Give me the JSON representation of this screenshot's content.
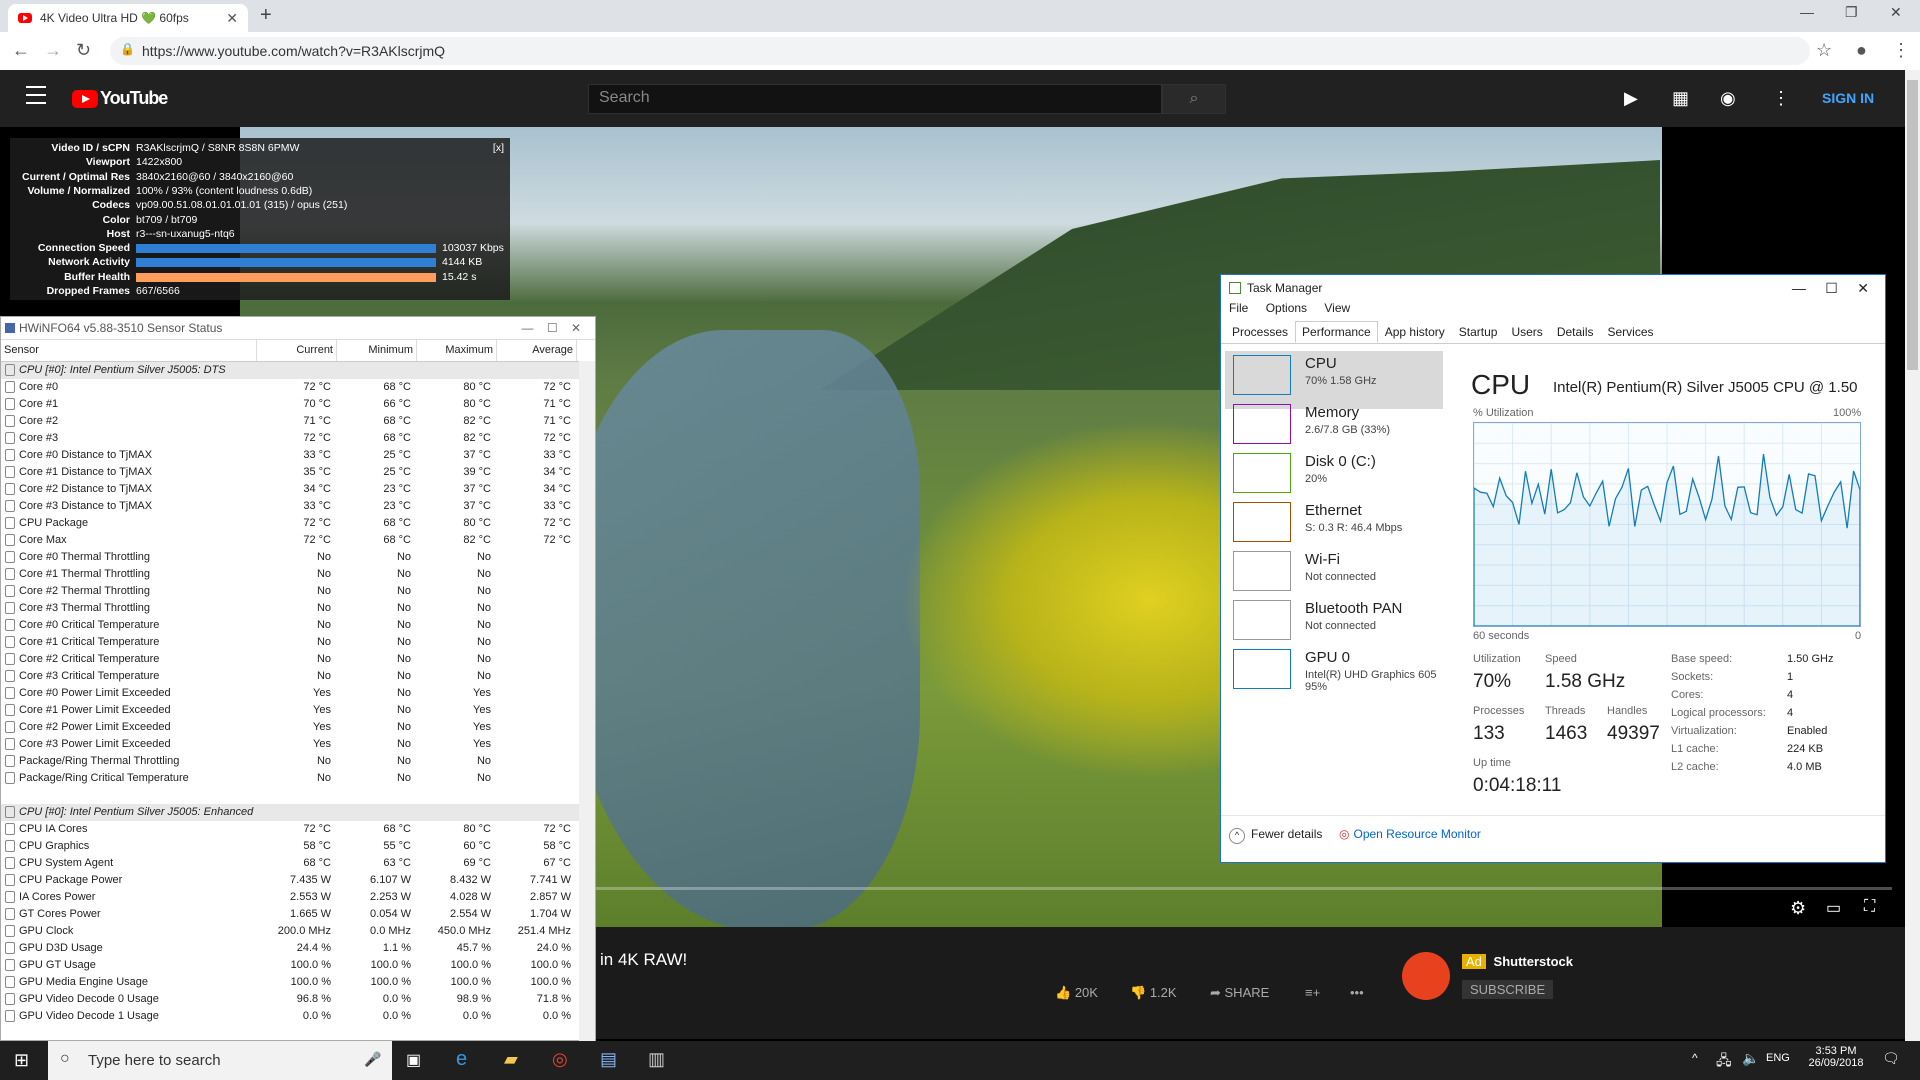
{
  "browser": {
    "tab_title": "4K Video Ultra HD 💚 60fps",
    "url": "https://www.youtube.com/watch?v=R3AKlscrjmQ"
  },
  "youtube": {
    "search_placeholder": "Search",
    "sign_in": "SIGN IN",
    "logo": "YouTube",
    "video_title": "in 4K RAW!",
    "likes": "20K",
    "dislikes": "1.2K",
    "share": "SHARE",
    "ad_label": "Ad",
    "ad_name": "Shutterstock",
    "subscribe": "SUBSCRIBE"
  },
  "stats": {
    "close": "[x]",
    "rows": [
      {
        "k": "Video ID / sCPN",
        "v": "R3AKlscrjmQ / S8NR 8S8N 6PMW"
      },
      {
        "k": "Viewport",
        "v": "1422x800"
      },
      {
        "k": "Current / Optimal Res",
        "v": "3840x2160@60 / 3840x2160@60"
      },
      {
        "k": "Volume / Normalized",
        "v": "100% / 93% (content loudness 0.6dB)"
      },
      {
        "k": "Codecs",
        "v": "vp09.00.51.08.01.01.01.01 (315) / opus (251)"
      },
      {
        "k": "Color",
        "v": "bt709 / bt709"
      },
      {
        "k": "Host",
        "v": "r3---sn-uxanug5-ntq6"
      },
      {
        "k": "Connection Speed",
        "v": "103037 Kbps"
      },
      {
        "k": "Network Activity",
        "v": "4144 KB"
      },
      {
        "k": "Buffer Health",
        "v": "15.42 s"
      },
      {
        "k": "Dropped Frames",
        "v": "667/6566"
      }
    ]
  },
  "hwinfo": {
    "title": "HWiNFO64 v5.88-3510 Sensor Status",
    "columns": [
      "Sensor",
      "Current",
      "Minimum",
      "Maximum",
      "Average"
    ],
    "rows": [
      {
        "group": true,
        "n": "CPU [#0]: Intel Pentium Silver J5005: DTS"
      },
      {
        "n": "Core #0",
        "c": "72 °C",
        "mi": "68 °C",
        "ma": "80 °C",
        "a": "72 °C"
      },
      {
        "n": "Core #1",
        "c": "70 °C",
        "mi": "66 °C",
        "ma": "80 °C",
        "a": "71 °C"
      },
      {
        "n": "Core #2",
        "c": "71 °C",
        "mi": "68 °C",
        "ma": "82 °C",
        "a": "71 °C"
      },
      {
        "n": "Core #3",
        "c": "72 °C",
        "mi": "68 °C",
        "ma": "82 °C",
        "a": "72 °C"
      },
      {
        "n": "Core #0 Distance to TjMAX",
        "c": "33 °C",
        "mi": "25 °C",
        "ma": "37 °C",
        "a": "33 °C"
      },
      {
        "n": "Core #1 Distance to TjMAX",
        "c": "35 °C",
        "mi": "25 °C",
        "ma": "39 °C",
        "a": "34 °C"
      },
      {
        "n": "Core #2 Distance to TjMAX",
        "c": "34 °C",
        "mi": "23 °C",
        "ma": "37 °C",
        "a": "34 °C"
      },
      {
        "n": "Core #3 Distance to TjMAX",
        "c": "33 °C",
        "mi": "23 °C",
        "ma": "37 °C",
        "a": "33 °C"
      },
      {
        "n": "CPU Package",
        "c": "72 °C",
        "mi": "68 °C",
        "ma": "80 °C",
        "a": "72 °C"
      },
      {
        "n": "Core Max",
        "c": "72 °C",
        "mi": "68 °C",
        "ma": "82 °C",
        "a": "72 °C"
      },
      {
        "n": "Core #0 Thermal Throttling",
        "c": "No",
        "mi": "No",
        "ma": "No",
        "a": ""
      },
      {
        "n": "Core #1 Thermal Throttling",
        "c": "No",
        "mi": "No",
        "ma": "No",
        "a": ""
      },
      {
        "n": "Core #2 Thermal Throttling",
        "c": "No",
        "mi": "No",
        "ma": "No",
        "a": ""
      },
      {
        "n": "Core #3 Thermal Throttling",
        "c": "No",
        "mi": "No",
        "ma": "No",
        "a": ""
      },
      {
        "n": "Core #0 Critical Temperature",
        "c": "No",
        "mi": "No",
        "ma": "No",
        "a": ""
      },
      {
        "n": "Core #1 Critical Temperature",
        "c": "No",
        "mi": "No",
        "ma": "No",
        "a": ""
      },
      {
        "n": "Core #2 Critical Temperature",
        "c": "No",
        "mi": "No",
        "ma": "No",
        "a": ""
      },
      {
        "n": "Core #3 Critical Temperature",
        "c": "No",
        "mi": "No",
        "ma": "No",
        "a": ""
      },
      {
        "n": "Core #0 Power Limit Exceeded",
        "c": "Yes",
        "mi": "No",
        "ma": "Yes",
        "a": ""
      },
      {
        "n": "Core #1 Power Limit Exceeded",
        "c": "Yes",
        "mi": "No",
        "ma": "Yes",
        "a": ""
      },
      {
        "n": "Core #2 Power Limit Exceeded",
        "c": "Yes",
        "mi": "No",
        "ma": "Yes",
        "a": ""
      },
      {
        "n": "Core #3 Power Limit Exceeded",
        "c": "Yes",
        "mi": "No",
        "ma": "Yes",
        "a": ""
      },
      {
        "n": "Package/Ring Thermal Throttling",
        "c": "No",
        "mi": "No",
        "ma": "No",
        "a": ""
      },
      {
        "n": "Package/Ring Critical Temperature",
        "c": "No",
        "mi": "No",
        "ma": "No",
        "a": ""
      },
      {
        "spacer": true
      },
      {
        "group": true,
        "n": "CPU [#0]: Intel Pentium Silver J5005: Enhanced"
      },
      {
        "n": "CPU IA Cores",
        "c": "72 °C",
        "mi": "68 °C",
        "ma": "80 °C",
        "a": "72 °C"
      },
      {
        "n": "CPU Graphics",
        "c": "58 °C",
        "mi": "55 °C",
        "ma": "60 °C",
        "a": "58 °C"
      },
      {
        "n": "CPU System Agent",
        "c": "68 °C",
        "mi": "63 °C",
        "ma": "69 °C",
        "a": "67 °C"
      },
      {
        "n": "CPU Package Power",
        "c": "7.435 W",
        "mi": "6.107 W",
        "ma": "8.432 W",
        "a": "7.741 W"
      },
      {
        "n": "IA Cores Power",
        "c": "2.553 W",
        "mi": "2.253 W",
        "ma": "4.028 W",
        "a": "2.857 W"
      },
      {
        "n": "GT Cores Power",
        "c": "1.665 W",
        "mi": "0.054 W",
        "ma": "2.554 W",
        "a": "1.704 W"
      },
      {
        "n": "GPU Clock",
        "c": "200.0 MHz",
        "mi": "0.0 MHz",
        "ma": "450.0 MHz",
        "a": "251.4 MHz"
      },
      {
        "n": "GPU D3D Usage",
        "c": "24.4 %",
        "mi": "1.1 %",
        "ma": "45.7 %",
        "a": "24.0 %"
      },
      {
        "n": "GPU GT Usage",
        "c": "100.0 %",
        "mi": "100.0 %",
        "ma": "100.0 %",
        "a": "100.0 %"
      },
      {
        "n": "GPU Media Engine Usage",
        "c": "100.0 %",
        "mi": "100.0 %",
        "ma": "100.0 %",
        "a": "100.0 %"
      },
      {
        "n": "GPU Video Decode 0 Usage",
        "c": "96.8 %",
        "mi": "0.0 %",
        "ma": "98.9 %",
        "a": "71.8 %"
      },
      {
        "n": "GPU Video Decode 1 Usage",
        "c": "0.0 %",
        "mi": "0.0 %",
        "ma": "0.0 %",
        "a": "0.0 %"
      }
    ]
  },
  "taskmgr": {
    "title": "Task Manager",
    "menu": [
      "File",
      "Options",
      "View"
    ],
    "tabs": [
      "Processes",
      "Performance",
      "App history",
      "Startup",
      "Users",
      "Details",
      "Services"
    ],
    "items": [
      {
        "t": "CPU",
        "s": "70% 1.58 GHz",
        "color": "#117dbb"
      },
      {
        "t": "Memory",
        "s": "2.6/7.8 GB (33%)",
        "color": "#8b12ae"
      },
      {
        "t": "Disk 0 (C:)",
        "s": "20%",
        "color": "#4da60c"
      },
      {
        "t": "Ethernet",
        "s": "S: 0.3 R: 46.4 Mbps",
        "color": "#a74f01"
      },
      {
        "t": "Wi-Fi",
        "s": "Not connected",
        "color": "#999999"
      },
      {
        "t": "Bluetooth PAN",
        "s": "Not connected",
        "color": "#999999"
      },
      {
        "t": "GPU 0",
        "s": "Intel(R) UHD Graphics 605\n95%",
        "color": "#117dbb"
      }
    ],
    "cpu_heading": "CPU",
    "cpu_name": "Intel(R) Pentium(R) Silver J5005 CPU @ 1.50",
    "util_label": "% Utilization",
    "util_max": "100%",
    "graph_seconds": "60 seconds",
    "graph_zero": "0",
    "utilization_l": "Utilization",
    "utilization_v": "70%",
    "speed_l": "Speed",
    "speed_v": "1.58 GHz",
    "processes_l": "Processes",
    "processes_v": "133",
    "threads_l": "Threads",
    "threads_v": "1463",
    "handles_l": "Handles",
    "handles_v": "49397",
    "uptime_l": "Up time",
    "uptime_v": "0:04:18:11",
    "specs": [
      {
        "k": "Base speed:",
        "v": "1.50 GHz"
      },
      {
        "k": "Sockets:",
        "v": "1"
      },
      {
        "k": "Cores:",
        "v": "4"
      },
      {
        "k": "Logical processors:",
        "v": "4"
      },
      {
        "k": "Virtualization:",
        "v": "Enabled"
      },
      {
        "k": "L1 cache:",
        "v": "224 KB"
      },
      {
        "k": "L2 cache:",
        "v": "4.0 MB"
      }
    ],
    "fewer_details": "Fewer details",
    "resource_monitor": "Open Resource Monitor"
  },
  "taskbar": {
    "search": "Type here to search",
    "lang": "ENG",
    "time": "3:53 PM",
    "date": "26/09/2018"
  }
}
